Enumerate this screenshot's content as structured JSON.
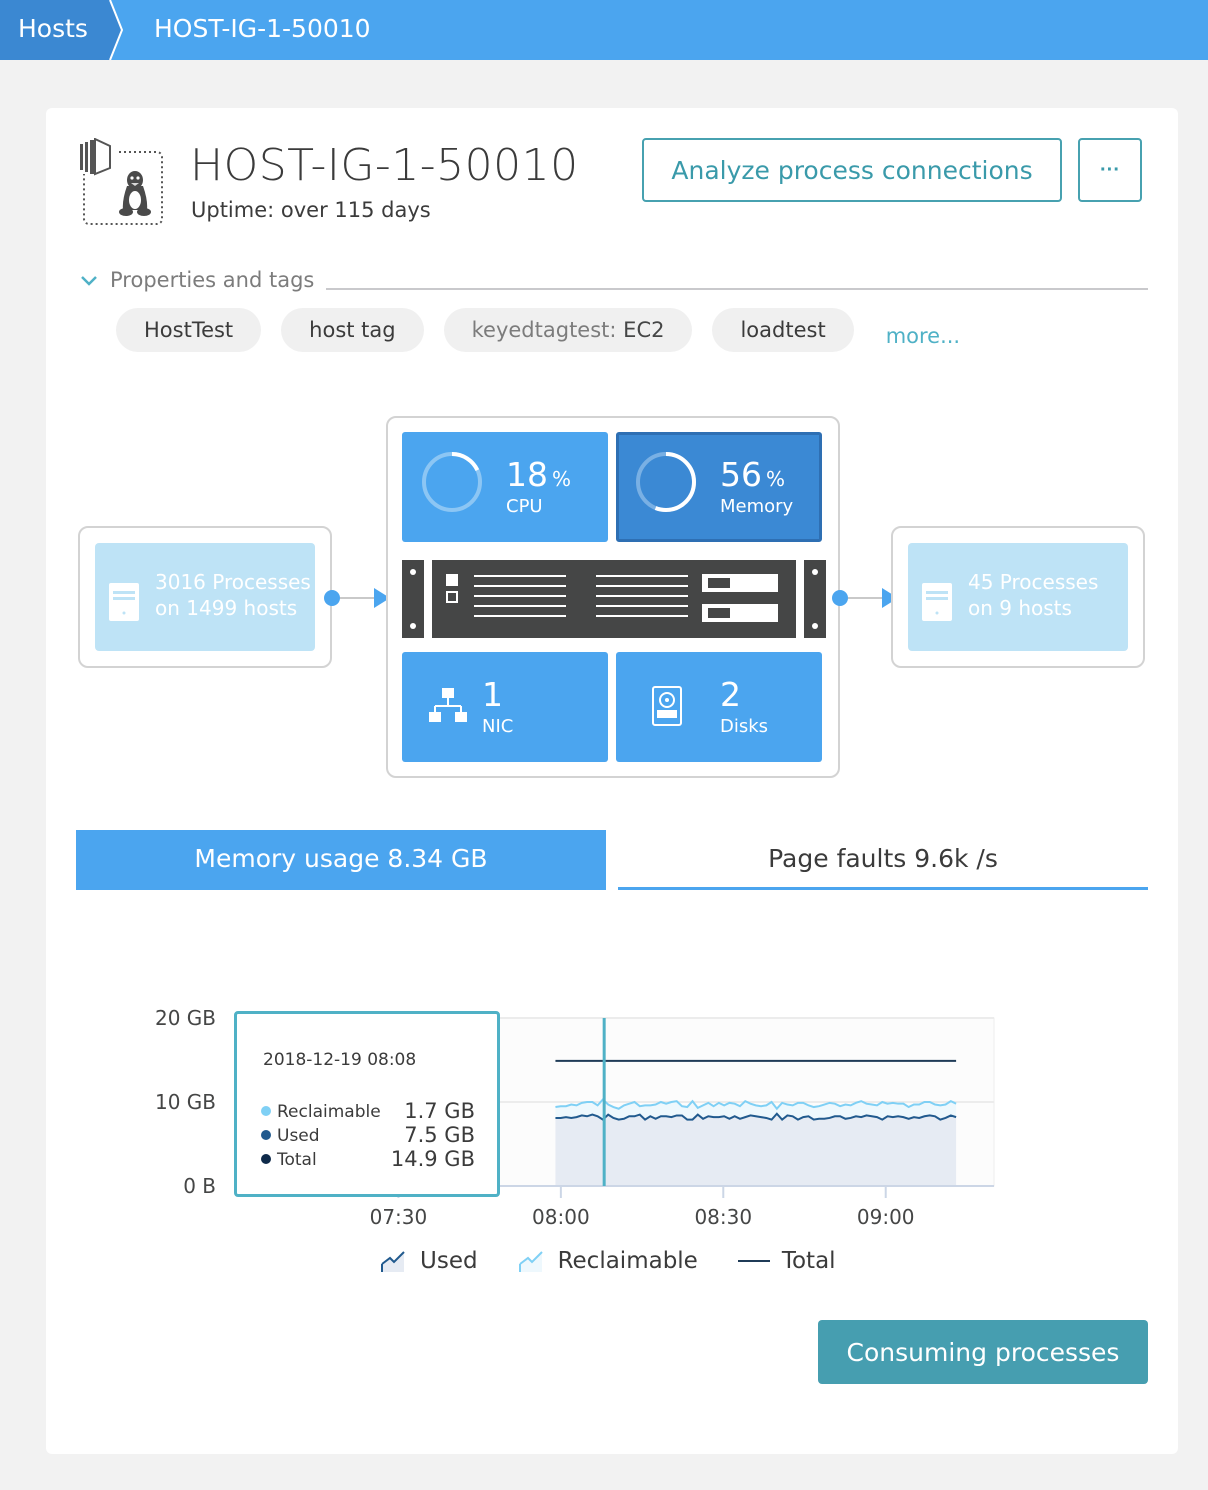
{
  "breadcrumb": {
    "root": "Hosts",
    "current": "HOST-IG-1-50010"
  },
  "host": {
    "name": "HOST-IG-1-50010",
    "uptime": "Uptime: over 115 days",
    "os_icon": "linux-penguin-icon"
  },
  "actions": {
    "analyze_label": "Analyze process connections",
    "more_label": "···"
  },
  "properties": {
    "toggle_label": "Properties and tags",
    "tags": [
      {
        "label": "HostTest"
      },
      {
        "label": "host tag"
      },
      {
        "key": "keyedtagtest:",
        "value": "EC2"
      },
      {
        "label": "loadtest"
      }
    ],
    "more_label": "more..."
  },
  "topology": {
    "incoming": {
      "line1": "3016 Processes",
      "line2": "on 1499 hosts"
    },
    "outgoing": {
      "line1": "45 Processes",
      "line2": "on 9 hosts"
    },
    "cpu": {
      "value": "18",
      "unit": "%",
      "label": "CPU",
      "fraction": 0.18
    },
    "memory": {
      "value": "56",
      "unit": "%",
      "label": "Memory",
      "fraction": 0.56
    },
    "nic": {
      "value": "1",
      "label": "NIC"
    },
    "disks": {
      "value": "2",
      "label": "Disks"
    }
  },
  "tabs": [
    {
      "label": "Memory usage 8.34 GB",
      "active": true
    },
    {
      "label": "Page faults 9.6k /s",
      "active": false
    }
  ],
  "tooltip": {
    "date": "2018-12-19 08:08",
    "rows": [
      {
        "name": "Reclaimable",
        "value": "1.7 GB",
        "color": "#7fd0f5"
      },
      {
        "name": "Used",
        "value": "7.5 GB",
        "color": "#215a8e"
      },
      {
        "name": "Total",
        "value": "14.9 GB",
        "color": "#0f2a4a"
      }
    ]
  },
  "chart_data": {
    "type": "area",
    "title": "Memory usage",
    "ylabel": "",
    "xlabel": "",
    "ylim": [
      0,
      20
    ],
    "yunit": "GB",
    "yticks": [
      "0 B",
      "10 GB",
      "20 GB"
    ],
    "ytick_values": [
      0,
      10,
      20
    ],
    "xticks": [
      "07:30",
      "08:00",
      "08:30",
      "09:00"
    ],
    "xtick_minutes": [
      450,
      480,
      510,
      540
    ],
    "xrange_minutes": [
      420,
      560
    ],
    "cursor_minute": 488,
    "series": [
      {
        "name": "Total",
        "color": "#1f3b57",
        "values_const": 14.9,
        "start_minute": 479
      },
      {
        "name": "Reclaimable",
        "color": "#7fd0f5",
        "fill": "#eef8fd",
        "start_minute": 479,
        "values": [
          9.4,
          9.5,
          9.5,
          9.7,
          9.6,
          9.9,
          10.0,
          10.0,
          9.6,
          10.3,
          9.7,
          9.4,
          9.2,
          9.6,
          9.8,
          10.0,
          9.5,
          9.6,
          9.6,
          9.7,
          10.0,
          9.8,
          10.0,
          10.1,
          9.5,
          9.4,
          10.1,
          9.3,
          9.6,
          9.9,
          9.5,
          9.9,
          9.6,
          9.9,
          9.8,
          9.5,
          10.1,
          9.8,
          9.6,
          9.5,
          9.6,
          10.0,
          9.2,
          9.9,
          9.7,
          9.6,
          9.9,
          9.9,
          9.6,
          9.4,
          9.5,
          9.7,
          9.9,
          9.8,
          9.5,
          9.7,
          9.6,
          9.9,
          10.1,
          9.8,
          9.7,
          9.6,
          10.0,
          9.8,
          9.9,
          9.8,
          9.8,
          9.4,
          9.7,
          9.7,
          10.0,
          10.0,
          9.7,
          9.6,
          9.7,
          10.1,
          9.8
        ]
      },
      {
        "name": "Used",
        "color": "#215a8e",
        "fill": "#e6ebf3",
        "start_minute": 479,
        "values": [
          8.1,
          8.1,
          8.2,
          8.1,
          8.2,
          8.4,
          8.3,
          8.5,
          8.3,
          7.9,
          8.5,
          8.1,
          7.9,
          8.0,
          8.3,
          8.3,
          8.5,
          7.9,
          8.3,
          8.0,
          8.3,
          8.3,
          8.2,
          8.4,
          8.4,
          7.9,
          7.9,
          8.5,
          8.0,
          8.3,
          8.2,
          8.2,
          8.3,
          8.0,
          8.3,
          8.0,
          8.2,
          8.4,
          8.3,
          8.2,
          8.1,
          7.9,
          8.6,
          7.9,
          8.4,
          8.3,
          7.9,
          8.2,
          8.3,
          7.9,
          8.0,
          8.0,
          8.1,
          8.3,
          8.3,
          8.0,
          8.1,
          8.3,
          8.2,
          8.4,
          8.3,
          8.2,
          7.9,
          8.3,
          8.2,
          8.3,
          8.2,
          8.0,
          8.2,
          8.1,
          8.3,
          8.4,
          8.3,
          7.9,
          8.1,
          8.4,
          8.2
        ]
      }
    ],
    "legend": [
      {
        "name": "Used",
        "icon": "area-used-icon"
      },
      {
        "name": "Reclaimable",
        "icon": "area-reclaimable-icon"
      },
      {
        "name": "Total",
        "icon": "line-total-icon"
      }
    ],
    "legend_position": "bottom-center",
    "grid": true
  },
  "footer": {
    "consume_label": "Consuming processes"
  }
}
